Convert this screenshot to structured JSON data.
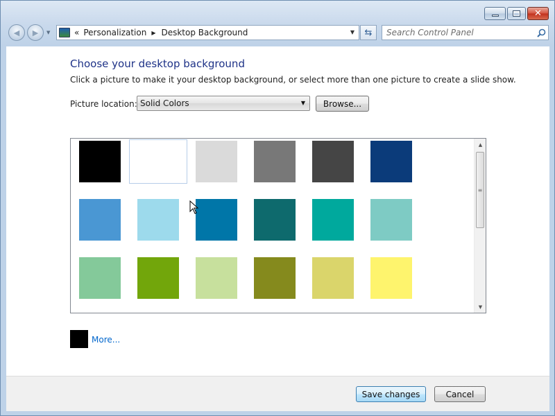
{
  "window": {
    "controls": [
      "minimize-icon",
      "maximize-icon",
      "close-icon"
    ]
  },
  "nav": {
    "back_icon": "back-arrow-icon",
    "forward_icon": "forward-arrow-icon",
    "breadcrumb_prefix": "«",
    "breadcrumbs": [
      "Personalization",
      "Desktop Background"
    ]
  },
  "search": {
    "placeholder": "Search Control Panel"
  },
  "main": {
    "heading": "Choose your desktop background",
    "description": "Click a picture to make it your desktop background, or select more than one picture to create a slide show.",
    "picture_location_label": "Picture location:",
    "picture_location_value": "Solid Colors",
    "browse_label": "Browse...",
    "more_label": "More...",
    "more_swatch_color": "#000000"
  },
  "colors": [
    [
      "#000000",
      "#ffffff",
      "#dadada",
      "#787878",
      "#454545",
      "#0b3b7a"
    ],
    [
      "#4a97d3",
      "#9ddaec",
      "#0076a8",
      "#0e6a6d",
      "#00a99d",
      "#7ecbc4"
    ],
    [
      "#84c99a",
      "#72a60b",
      "#c7e09d",
      "#858a1d",
      "#dad56b",
      "#fef46d"
    ]
  ],
  "selected_color": {
    "row": 0,
    "col": 1
  },
  "footer": {
    "save_label": "Save changes",
    "cancel_label": "Cancel"
  }
}
